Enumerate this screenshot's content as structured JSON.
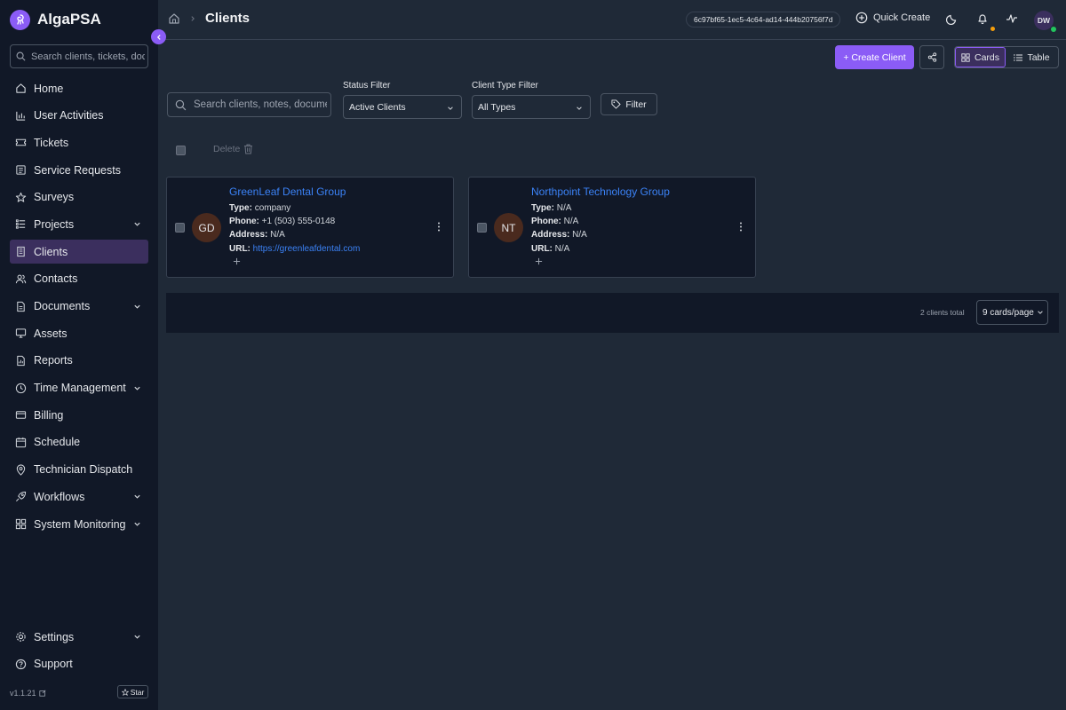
{
  "brand": {
    "name": "AlgaPSA"
  },
  "sidebar": {
    "search_placeholder": "Search clients, tickets, documents...",
    "items": [
      {
        "label": "Home",
        "icon": "home-icon"
      },
      {
        "label": "User Activities",
        "icon": "chart-icon"
      },
      {
        "label": "Tickets",
        "icon": "ticket-icon"
      },
      {
        "label": "Service Requests",
        "icon": "list-icon"
      },
      {
        "label": "Surveys",
        "icon": "star-icon"
      },
      {
        "label": "Projects",
        "icon": "project-icon",
        "expandable": true
      },
      {
        "label": "Clients",
        "icon": "building-icon",
        "active": true
      },
      {
        "label": "Contacts",
        "icon": "users-icon"
      },
      {
        "label": "Documents",
        "icon": "document-icon",
        "expandable": true
      },
      {
        "label": "Assets",
        "icon": "monitor-icon"
      },
      {
        "label": "Reports",
        "icon": "report-icon"
      },
      {
        "label": "Time Management",
        "icon": "clock-icon",
        "expandable": true
      },
      {
        "label": "Billing",
        "icon": "card-icon"
      },
      {
        "label": "Schedule",
        "icon": "calendar-icon"
      },
      {
        "label": "Technician Dispatch",
        "icon": "pin-icon"
      },
      {
        "label": "Workflows",
        "icon": "rocket-icon",
        "expandable": true
      },
      {
        "label": "System Monitoring",
        "icon": "grid-icon",
        "expandable": true
      }
    ],
    "settings_label": "Settings",
    "support_label": "Support",
    "version": "v1.1.21",
    "star_label": "Star"
  },
  "header": {
    "title": "Clients",
    "session_id": "6c97bf65-1ec5-4c64-ad14-444b20756f7d",
    "quick_create_label": "Quick Create",
    "user_initials": "DW"
  },
  "toolbar": {
    "create_client_label": "+ Create Client",
    "view_cards_label": "Cards",
    "view_table_label": "Table",
    "active_view": "Cards"
  },
  "filters": {
    "search_placeholder": "Search clients, notes, documents",
    "status_label": "Status Filter",
    "status_value": "Active Clients",
    "type_label": "Client Type Filter",
    "type_value": "All Types",
    "filter_button_label": "Filter"
  },
  "bulk": {
    "delete_label": "Delete"
  },
  "clients": [
    {
      "initials": "GD",
      "name": "GreenLeaf Dental Group",
      "type_label": "Type:",
      "type": "company",
      "phone_label": "Phone:",
      "phone": "+1 (503) 555-0148",
      "address_label": "Address:",
      "address": "N/A",
      "url_label": "URL:",
      "url": "https://greenleafdental.com"
    },
    {
      "initials": "NT",
      "name": "Northpoint Technology Group",
      "type_label": "Type:",
      "type": "N/A",
      "phone_label": "Phone:",
      "phone": "N/A",
      "address_label": "Address:",
      "address": "N/A",
      "url_label": "URL:",
      "url": "N/A"
    }
  ],
  "pagination": {
    "total_text": "2 clients total",
    "per_page": "9 cards/page"
  },
  "colors": {
    "accent": "#8b5cf6",
    "link": "#3b82f6",
    "background": "#1f2937",
    "sidebar": "#111827"
  }
}
